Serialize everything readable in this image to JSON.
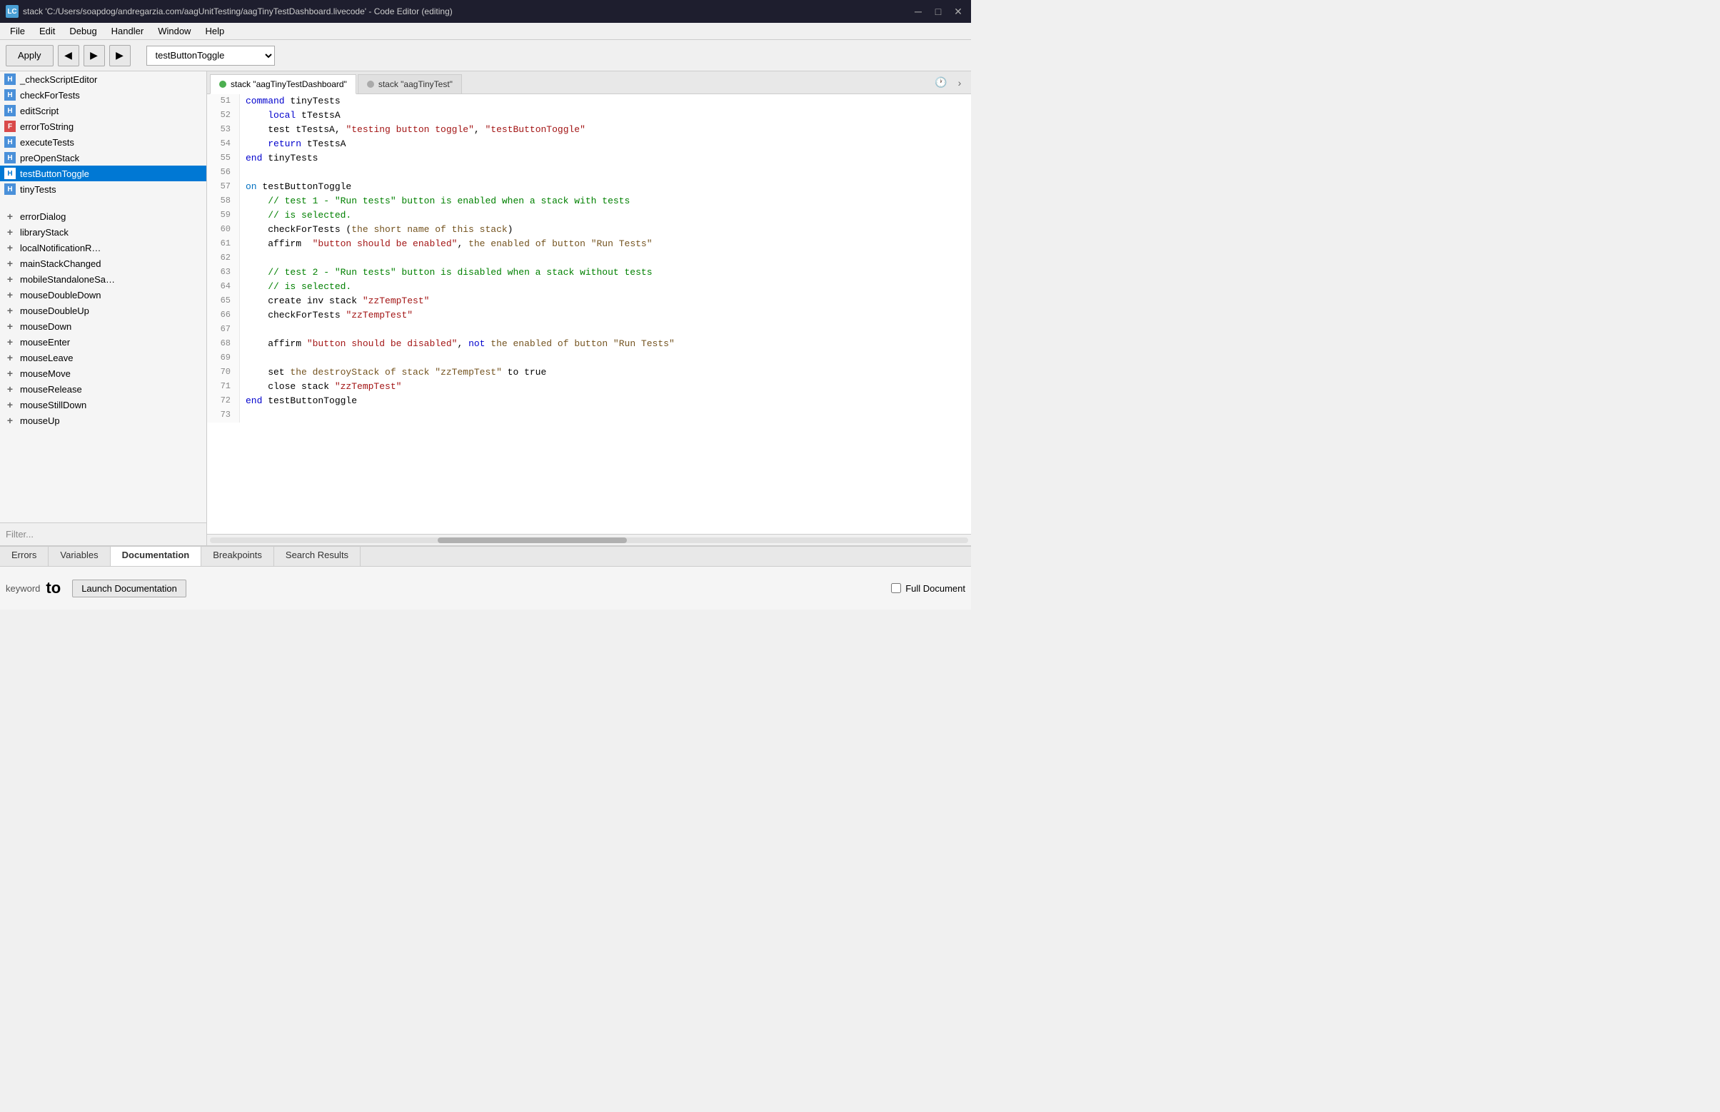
{
  "titlebar": {
    "icon_label": "LC",
    "title": "stack 'C:/Users/soapdog/andregarzia.com/aagUnitTesting/aagTinyTestDashboard.livecode' - Code Editor (editing)",
    "minimize": "─",
    "maximize": "□",
    "close": "✕"
  },
  "menubar": {
    "items": [
      "File",
      "Edit",
      "Debug",
      "Handler",
      "Window",
      "Help"
    ]
  },
  "toolbar": {
    "apply_label": "Apply",
    "back_icon": "◀",
    "forward_icon": "▶",
    "run_icon": "▶",
    "handler_name": "testButtonToggle",
    "dropdown_arrow": "▼"
  },
  "sidebar": {
    "handlers": [
      {
        "icon": "H",
        "color": "blue",
        "name": "_checkScriptEditor",
        "selected": false
      },
      {
        "icon": "H",
        "color": "blue",
        "name": "checkForTests",
        "selected": false
      },
      {
        "icon": "H",
        "color": "blue",
        "name": "editScript",
        "selected": false
      },
      {
        "icon": "F",
        "color": "red",
        "name": "errorToString",
        "selected": false
      },
      {
        "icon": "H",
        "color": "blue",
        "name": "executeTests",
        "selected": false
      },
      {
        "icon": "H",
        "color": "blue",
        "name": "preOpenStack",
        "selected": false
      },
      {
        "icon": "H",
        "color": "blue",
        "name": "testButtonToggle",
        "selected": true
      },
      {
        "icon": "H",
        "color": "blue",
        "name": "tinyTests",
        "selected": false
      }
    ],
    "others": [
      {
        "icon": "+",
        "name": "errorDialog"
      },
      {
        "icon": "+",
        "name": "libraryStack"
      },
      {
        "icon": "+",
        "name": "localNotificationR…"
      },
      {
        "icon": "+",
        "name": "mainStackChanged"
      },
      {
        "icon": "+",
        "name": "mobileStandaloneSa…"
      },
      {
        "icon": "+",
        "name": "mouseDoubleDown"
      },
      {
        "icon": "+",
        "name": "mouseDoubleUp"
      },
      {
        "icon": "+",
        "name": "mouseDown"
      },
      {
        "icon": "+",
        "name": "mouseEnter"
      },
      {
        "icon": "+",
        "name": "mouseLeave"
      },
      {
        "icon": "+",
        "name": "mouseMove"
      },
      {
        "icon": "+",
        "name": "mouseRelease"
      },
      {
        "icon": "+",
        "name": "mouseStillDown"
      },
      {
        "icon": "+",
        "name": "mouseUp"
      }
    ],
    "filter_placeholder": "Filter..."
  },
  "tabs": [
    {
      "label": "stack \"aagTinyTestDashboard\"",
      "indicator": "green",
      "active": true
    },
    {
      "label": "stack \"aagTinyTest\"",
      "indicator": "gray",
      "active": false
    }
  ],
  "code_lines": [
    {
      "num": 51,
      "tokens": [
        {
          "type": "kw",
          "text": "command"
        },
        {
          "type": "plain",
          "text": " tinyTests"
        }
      ]
    },
    {
      "num": 52,
      "tokens": [
        {
          "type": "plain",
          "text": "    "
        },
        {
          "type": "kw",
          "text": "local"
        },
        {
          "type": "plain",
          "text": " tTestsA"
        }
      ]
    },
    {
      "num": 53,
      "tokens": [
        {
          "type": "plain",
          "text": "    test tTestsA, "
        },
        {
          "type": "str",
          "text": "\"testing button toggle\""
        },
        {
          "type": "plain",
          "text": ", "
        },
        {
          "type": "str",
          "text": "\"testButtonToggle\""
        }
      ]
    },
    {
      "num": 54,
      "tokens": [
        {
          "type": "plain",
          "text": "    "
        },
        {
          "type": "kw",
          "text": "return"
        },
        {
          "type": "plain",
          "text": " tTestsA"
        }
      ]
    },
    {
      "num": 55,
      "tokens": [
        {
          "type": "kw",
          "text": "end"
        },
        {
          "type": "plain",
          "text": " tinyTests"
        }
      ]
    },
    {
      "num": 56,
      "tokens": [
        {
          "type": "plain",
          "text": ""
        }
      ]
    },
    {
      "num": 57,
      "tokens": [
        {
          "type": "kw2",
          "text": "on"
        },
        {
          "type": "plain",
          "text": " testButtonToggle"
        }
      ]
    },
    {
      "num": 58,
      "tokens": [
        {
          "type": "cmt",
          "text": "    // test 1 - \"Run tests\" button is enabled when a stack with tests"
        }
      ]
    },
    {
      "num": 59,
      "tokens": [
        {
          "type": "cmt",
          "text": "    // is selected."
        }
      ]
    },
    {
      "num": 60,
      "tokens": [
        {
          "type": "plain",
          "text": "    checkForTests ("
        },
        {
          "type": "prop",
          "text": "the short name of this stack"
        },
        {
          "type": "plain",
          "text": ")"
        }
      ]
    },
    {
      "num": 61,
      "tokens": [
        {
          "type": "plain",
          "text": "    affirm  "
        },
        {
          "type": "str",
          "text": "\"button should be enabled\""
        },
        {
          "type": "plain",
          "text": ", "
        },
        {
          "type": "prop",
          "text": "the enabled of button \"Run Tests\""
        }
      ]
    },
    {
      "num": 62,
      "tokens": [
        {
          "type": "plain",
          "text": ""
        }
      ]
    },
    {
      "num": 63,
      "tokens": [
        {
          "type": "cmt",
          "text": "    // test 2 - \"Run tests\" button is disabled when a stack without tests"
        }
      ]
    },
    {
      "num": 64,
      "tokens": [
        {
          "type": "cmt",
          "text": "    // is selected."
        }
      ]
    },
    {
      "num": 65,
      "tokens": [
        {
          "type": "plain",
          "text": "    create inv stack "
        },
        {
          "type": "str",
          "text": "\"zzTempTest\""
        }
      ]
    },
    {
      "num": 66,
      "tokens": [
        {
          "type": "plain",
          "text": "    checkForTests "
        },
        {
          "type": "str",
          "text": "\"zzTempTest\""
        }
      ]
    },
    {
      "num": 67,
      "tokens": [
        {
          "type": "plain",
          "text": ""
        }
      ]
    },
    {
      "num": 68,
      "tokens": [
        {
          "type": "plain",
          "text": "    affirm "
        },
        {
          "type": "str",
          "text": "\"button should be disabled\""
        },
        {
          "type": "plain",
          "text": ", "
        },
        {
          "type": "kw",
          "text": "not"
        },
        {
          "type": "plain",
          "text": " "
        },
        {
          "type": "prop",
          "text": "the enabled of button \"Run Tests\""
        }
      ]
    },
    {
      "num": 69,
      "tokens": [
        {
          "type": "plain",
          "text": ""
        }
      ]
    },
    {
      "num": 70,
      "tokens": [
        {
          "type": "plain",
          "text": "    set "
        },
        {
          "type": "prop",
          "text": "the destroyStack of stack \"zzTempTest\""
        },
        {
          "type": "plain",
          "text": " to true"
        }
      ]
    },
    {
      "num": 71,
      "tokens": [
        {
          "type": "plain",
          "text": "    close stack "
        },
        {
          "type": "str",
          "text": "\"zzTempTest\""
        }
      ]
    },
    {
      "num": 72,
      "tokens": [
        {
          "type": "kw",
          "text": "end"
        },
        {
          "type": "plain",
          "text": " testButtonToggle"
        }
      ]
    },
    {
      "num": 73,
      "tokens": [
        {
          "type": "plain",
          "text": ""
        }
      ]
    }
  ],
  "bottom_tabs": [
    {
      "label": "Errors",
      "active": false
    },
    {
      "label": "Variables",
      "active": false
    },
    {
      "label": "Documentation",
      "active": true
    },
    {
      "label": "Breakpoints",
      "active": false
    },
    {
      "label": "Search Results",
      "active": false
    }
  ],
  "documentation": {
    "keyword_label": "keyword",
    "keyword_value": "to",
    "launch_btn": "Launch Documentation",
    "full_doc_label": "Full Document"
  }
}
